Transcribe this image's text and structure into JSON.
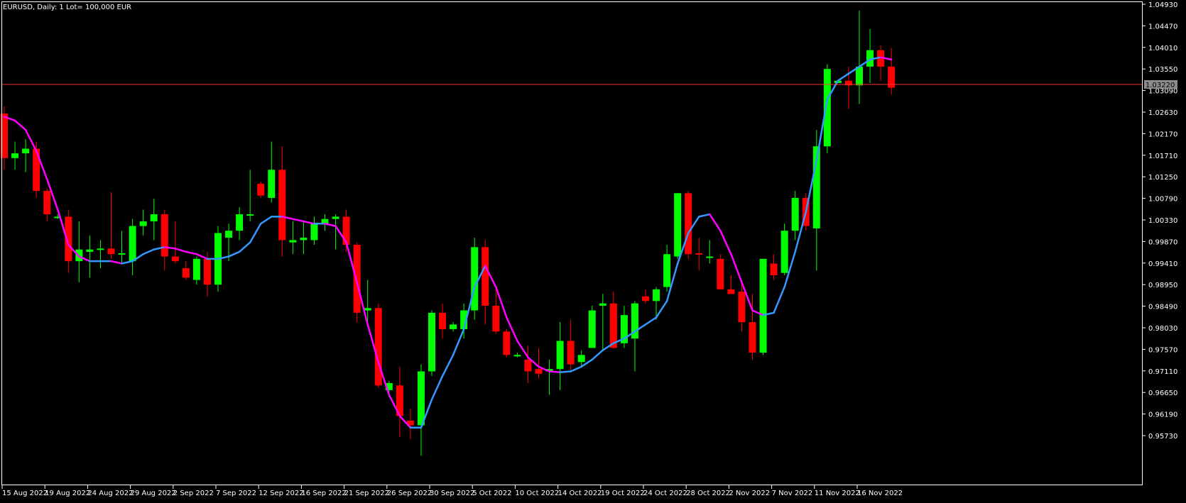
{
  "header": {
    "symbol": "EURUSD",
    "timeframe": "Daily",
    "lot_info": "1 Lot= 100,000 EUR",
    "text": "EURUSD, Daily:  1 Lot= 100,000 EUR"
  },
  "colors": {
    "background": "#000000",
    "frame": "#ffffff",
    "bull_candle": "#00ff00",
    "bear_candle": "#ff0000",
    "ma_up": "#3399ff",
    "ma_down": "#ff00ff",
    "price_line": "#ff3333",
    "price_tag_bg": "#8c8c8c"
  },
  "chart_data": {
    "type": "candlestick",
    "symbol": "EURUSD",
    "timeframe": "Daily",
    "current_price": 1.0322,
    "current_price_label": "1.03220",
    "ylim": [
      0.955,
      1.05
    ],
    "y_ticks": [
      "1.04930",
      "1.04470",
      "1.04010",
      "1.03550",
      "1.03090",
      "1.02630",
      "1.02170",
      "1.01710",
      "1.01250",
      "1.00790",
      "1.00330",
      "0.99870",
      "0.99410",
      "0.98950",
      "0.98490",
      "0.98030",
      "0.97570",
      "0.97110",
      "0.96650",
      "0.96190",
      "0.95730"
    ],
    "x_labels": [
      {
        "label": "15 Aug 2022",
        "index": 0
      },
      {
        "label": "19 Aug 2022",
        "index": 4
      },
      {
        "label": "24 Aug 2022",
        "index": 8
      },
      {
        "label": "29 Aug 2022",
        "index": 12
      },
      {
        "label": "2 Sep 2022",
        "index": 16
      },
      {
        "label": "7 Sep 2022",
        "index": 20
      },
      {
        "label": "12 Sep 2022",
        "index": 24
      },
      {
        "label": "16 Sep 2022",
        "index": 28
      },
      {
        "label": "21 Sep 2022",
        "index": 32
      },
      {
        "label": "26 Sep 2022",
        "index": 36
      },
      {
        "label": "30 Sep 2022",
        "index": 40
      },
      {
        "label": "5 Oct 2022",
        "index": 44
      },
      {
        "label": "10 Oct 2022",
        "index": 48
      },
      {
        "label": "14 Oct 2022",
        "index": 52
      },
      {
        "label": "19 Oct 2022",
        "index": 56
      },
      {
        "label": "24 Oct 2022",
        "index": 60
      },
      {
        "label": "28 Oct 2022",
        "index": 64
      },
      {
        "label": "2 Nov 2022",
        "index": 68
      },
      {
        "label": "7 Nov 2022",
        "index": 72
      },
      {
        "label": "11 Nov 2022",
        "index": 76
      },
      {
        "label": "16 Nov 2022",
        "index": 80
      }
    ],
    "candles": [
      {
        "o": 1.026,
        "h": 1.0275,
        "l": 1.014,
        "c": 1.0165
      },
      {
        "o": 1.0165,
        "h": 1.02,
        "l": 1.014,
        "c": 1.0175
      },
      {
        "o": 1.0175,
        "h": 1.0205,
        "l": 1.0135,
        "c": 1.0185
      },
      {
        "o": 1.0185,
        "h": 1.02,
        "l": 1.008,
        "c": 1.0095
      },
      {
        "o": 1.0095,
        "h": 1.01,
        "l": 1.003,
        "c": 1.0045
      },
      {
        "o": 1.004,
        "h": 1.0045,
        "l": 1.0035,
        "c": 1.004
      },
      {
        "o": 1.004,
        "h": 1.0055,
        "l": 0.992,
        "c": 0.9945
      },
      {
        "o": 0.9945,
        "h": 1.003,
        "l": 0.99,
        "c": 0.997
      },
      {
        "o": 0.9965,
        "h": 1.0,
        "l": 0.991,
        "c": 0.997
      },
      {
        "o": 0.997,
        "h": 0.999,
        "l": 0.993,
        "c": 0.9972
      },
      {
        "o": 0.9972,
        "h": 1.0092,
        "l": 0.995,
        "c": 0.996
      },
      {
        "o": 0.996,
        "h": 1.001,
        "l": 0.994,
        "c": 0.9962
      },
      {
        "o": 0.9945,
        "h": 1.0035,
        "l": 0.9915,
        "c": 1.002
      },
      {
        "o": 1.002,
        "h": 1.0055,
        "l": 1.0,
        "c": 1.003
      },
      {
        "o": 1.003,
        "h": 1.0078,
        "l": 0.999,
        "c": 1.0045
      },
      {
        "o": 1.0045,
        "h": 1.0055,
        "l": 0.9925,
        "c": 0.9955
      },
      {
        "o": 0.9955,
        "h": 1.003,
        "l": 0.994,
        "c": 0.9945
      },
      {
        "o": 0.993,
        "h": 0.9945,
        "l": 0.9905,
        "c": 0.991
      },
      {
        "o": 0.9905,
        "h": 0.9955,
        "l": 0.9895,
        "c": 0.995
      },
      {
        "o": 0.995,
        "h": 0.9965,
        "l": 0.987,
        "c": 0.9895
      },
      {
        "o": 0.9895,
        "h": 1.002,
        "l": 0.988,
        "c": 1.0005
      },
      {
        "o": 0.9995,
        "h": 1.0025,
        "l": 0.9945,
        "c": 1.001
      },
      {
        "o": 1.001,
        "h": 1.006,
        "l": 0.999,
        "c": 1.0045
      },
      {
        "o": 1.0045,
        "h": 1.014,
        "l": 1.003,
        "c": 1.0045
      },
      {
        "o": 1.011,
        "h": 1.0115,
        "l": 1.008,
        "c": 1.0085
      },
      {
        "o": 1.008,
        "h": 1.02,
        "l": 1.007,
        "c": 1.014
      },
      {
        "o": 1.014,
        "h": 1.019,
        "l": 0.9955,
        "c": 0.999
      },
      {
        "o": 0.9985,
        "h": 1.003,
        "l": 0.996,
        "c": 0.999
      },
      {
        "o": 0.999,
        "h": 1.003,
        "l": 0.996,
        "c": 0.9995
      },
      {
        "o": 0.999,
        "h": 1.004,
        "l": 0.998,
        "c": 1.0025
      },
      {
        "o": 1.0025,
        "h": 1.0045,
        "l": 1.001,
        "c": 1.0035
      },
      {
        "o": 1.0035,
        "h": 1.0045,
        "l": 0.997,
        "c": 1.004
      },
      {
        "o": 1.004,
        "h": 1.0055,
        "l": 0.9965,
        "c": 0.998
      },
      {
        "o": 0.998,
        "h": 0.9985,
        "l": 0.9815,
        "c": 0.9835
      },
      {
        "o": 0.984,
        "h": 0.9905,
        "l": 0.981,
        "c": 0.9845
      },
      {
        "o": 0.9845,
        "h": 0.9855,
        "l": 0.9675,
        "c": 0.968
      },
      {
        "o": 0.967,
        "h": 0.969,
        "l": 0.9655,
        "c": 0.9685
      },
      {
        "o": 0.968,
        "h": 0.972,
        "l": 0.957,
        "c": 0.9615
      },
      {
        "o": 0.9605,
        "h": 0.963,
        "l": 0.9565,
        "c": 0.9595
      },
      {
        "o": 0.9595,
        "h": 0.9725,
        "l": 0.953,
        "c": 0.971
      },
      {
        "o": 0.971,
        "h": 0.984,
        "l": 0.97,
        "c": 0.9835
      },
      {
        "o": 0.9835,
        "h": 0.9855,
        "l": 0.978,
        "c": 0.98
      },
      {
        "o": 0.98,
        "h": 0.9815,
        "l": 0.9795,
        "c": 0.981
      },
      {
        "o": 0.98,
        "h": 0.9855,
        "l": 0.978,
        "c": 0.984
      },
      {
        "o": 0.984,
        "h": 0.9995,
        "l": 0.982,
        "c": 0.9975
      },
      {
        "o": 0.9975,
        "h": 0.999,
        "l": 0.981,
        "c": 0.985
      },
      {
        "o": 0.985,
        "h": 0.9885,
        "l": 0.979,
        "c": 0.9795
      },
      {
        "o": 0.9795,
        "h": 0.98,
        "l": 0.974,
        "c": 0.9745
      },
      {
        "o": 0.9745,
        "h": 0.975,
        "l": 0.974,
        "c": 0.9745
      },
      {
        "o": 0.9735,
        "h": 0.9765,
        "l": 0.9685,
        "c": 0.971
      },
      {
        "o": 0.9715,
        "h": 0.976,
        "l": 0.9695,
        "c": 0.9705
      },
      {
        "o": 0.971,
        "h": 0.9735,
        "l": 0.966,
        "c": 0.9715
      },
      {
        "o": 0.9715,
        "h": 0.9815,
        "l": 0.967,
        "c": 0.9775
      },
      {
        "o": 0.9775,
        "h": 0.982,
        "l": 0.971,
        "c": 0.9725
      },
      {
        "o": 0.973,
        "h": 0.9755,
        "l": 0.972,
        "c": 0.9745
      },
      {
        "o": 0.976,
        "h": 0.985,
        "l": 0.976,
        "c": 0.984
      },
      {
        "o": 0.985,
        "h": 0.9875,
        "l": 0.9755,
        "c": 0.9855
      },
      {
        "o": 0.9855,
        "h": 0.988,
        "l": 0.977,
        "c": 0.976
      },
      {
        "o": 0.977,
        "h": 0.985,
        "l": 0.976,
        "c": 0.983
      },
      {
        "o": 0.978,
        "h": 0.986,
        "l": 0.971,
        "c": 0.9855
      },
      {
        "o": 0.987,
        "h": 0.9885,
        "l": 0.9855,
        "c": 0.986
      },
      {
        "o": 0.986,
        "h": 0.989,
        "l": 0.982,
        "c": 0.9885
      },
      {
        "o": 0.989,
        "h": 0.998,
        "l": 0.988,
        "c": 0.996
      },
      {
        "o": 0.9955,
        "h": 1.009,
        "l": 0.995,
        "c": 1.009
      },
      {
        "o": 1.009,
        "h": 1.0095,
        "l": 0.995,
        "c": 0.996
      },
      {
        "o": 0.9962,
        "h": 0.9995,
        "l": 0.9925,
        "c": 0.996
      },
      {
        "o": 0.9955,
        "h": 0.999,
        "l": 0.994,
        "c": 0.9955
      },
      {
        "o": 0.995,
        "h": 0.996,
        "l": 0.9885,
        "c": 0.9885
      },
      {
        "o": 0.9885,
        "h": 0.9915,
        "l": 0.9875,
        "c": 0.9875
      },
      {
        "o": 0.988,
        "h": 0.9905,
        "l": 0.9795,
        "c": 0.9815
      },
      {
        "o": 0.9815,
        "h": 0.9875,
        "l": 0.9735,
        "c": 0.975
      },
      {
        "o": 0.975,
        "h": 0.995,
        "l": 0.9745,
        "c": 0.995
      },
      {
        "o": 0.994,
        "h": 0.996,
        "l": 0.9905,
        "c": 0.9915
      },
      {
        "o": 0.992,
        "h": 1.0025,
        "l": 0.9915,
        "c": 1.001
      },
      {
        "o": 1.001,
        "h": 1.0095,
        "l": 0.999,
        "c": 1.008
      },
      {
        "o": 1.008,
        "h": 1.009,
        "l": 1.001,
        "c": 1.002
      },
      {
        "o": 1.0015,
        "h": 1.0225,
        "l": 0.9925,
        "c": 1.019
      },
      {
        "o": 1.019,
        "h": 1.0365,
        "l": 1.0175,
        "c": 1.0355
      },
      {
        "o": 1.0325,
        "h": 1.033,
        "l": 1.0325,
        "c": 1.033
      },
      {
        "o": 1.033,
        "h": 1.036,
        "l": 1.027,
        "c": 1.032
      },
      {
        "o": 1.032,
        "h": 1.048,
        "l": 1.028,
        "c": 1.036
      },
      {
        "o": 1.036,
        "h": 1.044,
        "l": 1.0325,
        "c": 1.0395
      },
      {
        "o": 1.0395,
        "h": 1.0405,
        "l": 1.033,
        "c": 1.036
      },
      {
        "o": 1.036,
        "h": 1.04,
        "l": 1.03,
        "c": 1.0315
      }
    ],
    "moving_average": [
      1.0253,
      1.0245,
      1.0225,
      1.018,
      1.012,
      1.0055,
      0.998,
      0.9955,
      0.9945,
      0.9945,
      0.9945,
      0.994,
      0.9945,
      0.996,
      0.997,
      0.9975,
      0.9972,
      0.9965,
      0.996,
      0.995,
      0.995,
      0.9955,
      0.9965,
      0.9985,
      1.0025,
      1.004,
      1.004,
      1.0035,
      1.003,
      1.0025,
      1.0025,
      1.002,
      0.9985,
      0.99,
      0.981,
      0.973,
      0.966,
      0.9615,
      0.959,
      0.959,
      0.965,
      0.97,
      0.9745,
      0.98,
      0.989,
      0.9935,
      0.989,
      0.9825,
      0.9775,
      0.974,
      0.972,
      0.971,
      0.9708,
      0.971,
      0.972,
      0.9735,
      0.9755,
      0.977,
      0.978,
      0.9795,
      0.981,
      0.9825,
      0.986,
      0.994,
      1.0005,
      1.004,
      1.0045,
      1.001,
      0.996,
      0.99,
      0.984,
      0.983,
      0.9835,
      0.989,
      0.9965,
      1.005,
      1.016,
      1.029,
      1.033,
      1.0345,
      1.036,
      1.0375,
      1.038,
      1.0375
    ]
  }
}
